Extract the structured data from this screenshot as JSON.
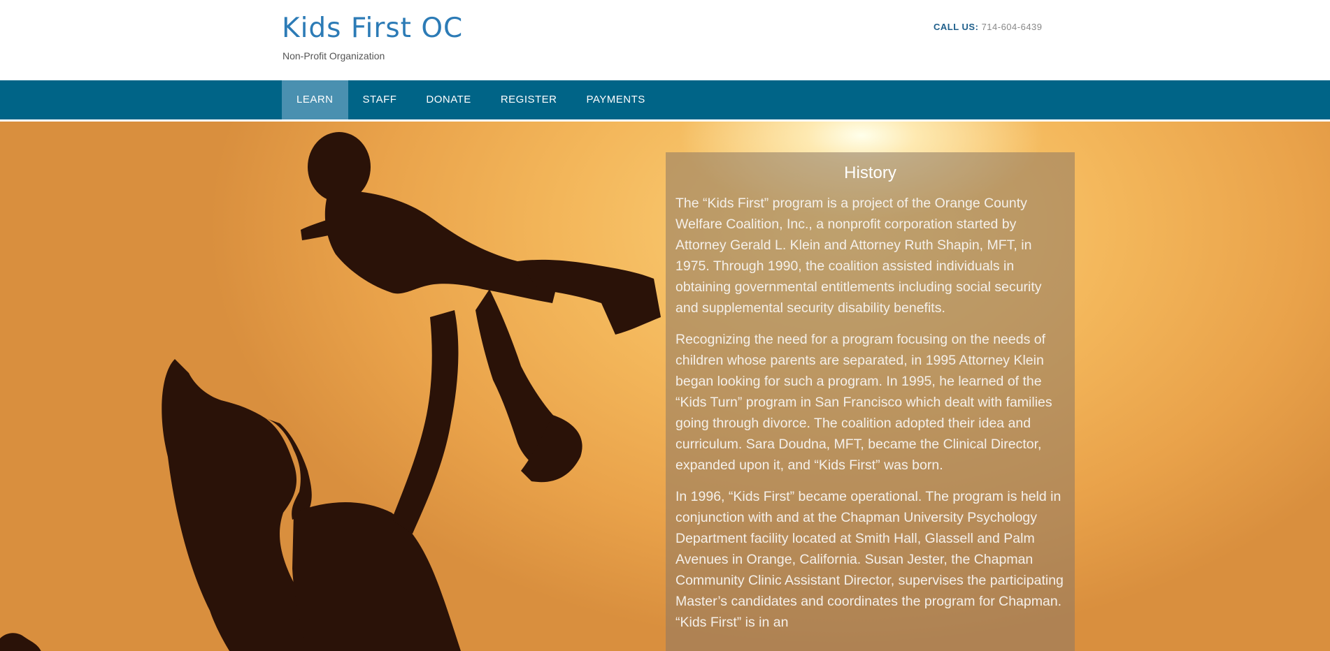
{
  "header": {
    "site_title": "Kids First OC",
    "tagline": "Non-Profit Organization",
    "call_label": "CALL US:",
    "phone": "714-604-6439"
  },
  "nav": {
    "items": [
      {
        "label": "LEARN",
        "active": true
      },
      {
        "label": "STAFF",
        "active": false
      },
      {
        "label": "DONATE",
        "active": false
      },
      {
        "label": "REGISTER",
        "active": false
      },
      {
        "label": "PAYMENTS",
        "active": false
      }
    ]
  },
  "history": {
    "title": "History",
    "paragraphs": [
      "The “Kids First” program is a project of the Orange County Welfare Coalition, Inc., a nonprofit corporation started by Attorney Gerald L. Klein and Attorney Ruth Shapin, MFT, in 1975. Through 1990, the coalition assisted individuals in obtaining governmental entitlements including social security and supplemental security disability benefits.",
      "Recognizing the need for a program focusing on the needs of children whose parents are separated, in 1995 Attorney Klein began looking for such a program. In 1995, he learned of the “Kids Turn” program in San Francisco which dealt with families going through divorce. The coalition adopted their idea and curriculum. Sara Doudna, MFT, became the Clinical Director, expanded upon it, and “Kids First” was born.",
      "In 1996, “Kids First” became operational. The program is held in conjunction with and at the Chapman University Psychology Department facility located at Smith Hall, Glassell and Palm Avenues in Orange, California. Susan Jester, the Chapman Community Clinic Assistant Director, supervises the participating Master’s candidates and coordinates the program for Chapman. “Kids First” is in an"
    ]
  },
  "colors": {
    "nav_bg": "#006487",
    "nav_active": "#4a90b0",
    "title_blue": "#2c7bb6"
  }
}
